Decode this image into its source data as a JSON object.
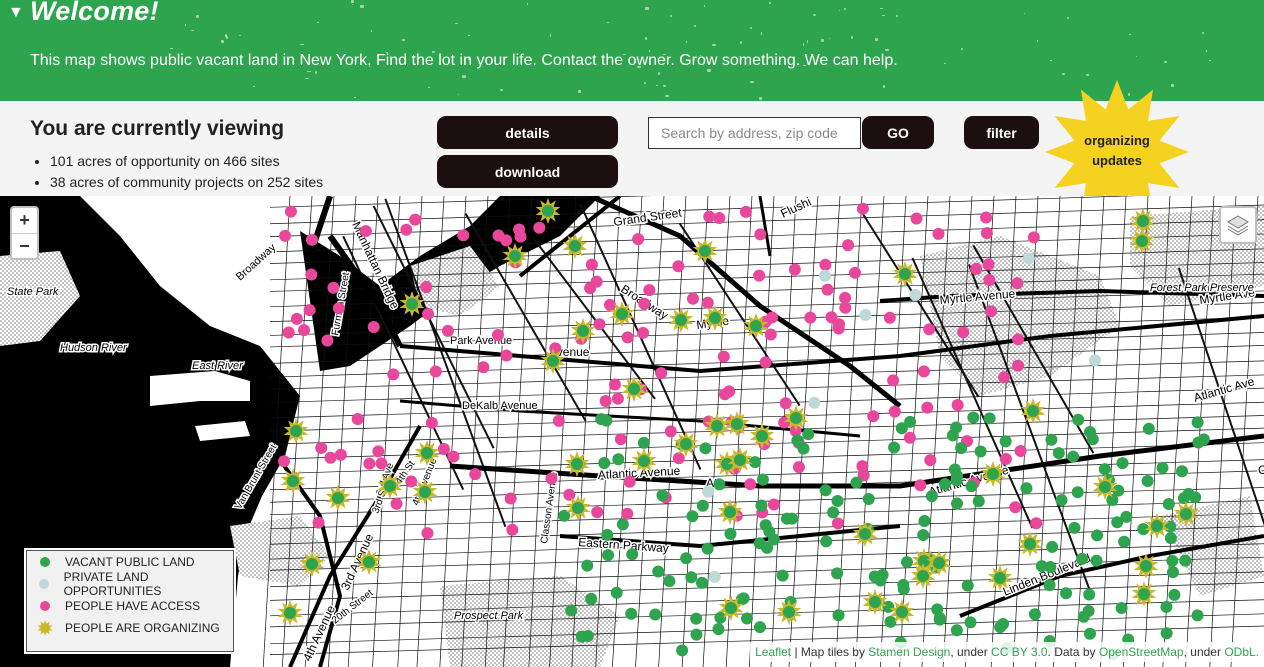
{
  "banner": {
    "title": "Welcome!",
    "collapse_glyph": "▼",
    "tagline": "This map shows public vacant land in New York. Find the lot in your life. Contact the owner. Grow something. We can help."
  },
  "panel": {
    "heading": "You are currently viewing",
    "stats": [
      "101 acres of opportunity on 466 sites",
      "38 acres of community projects on 252 sites"
    ],
    "details_label": "details",
    "download_label": "download",
    "search_placeholder": "Search by address, zip code",
    "go_label": "GO",
    "filter_label": "filter",
    "organizing_line1": "organizing",
    "organizing_line2": "updates"
  },
  "map": {
    "zoom_in": "+",
    "zoom_out": "−",
    "layers_icon": "layers-icon",
    "labels": {
      "grand_street": "Grand Street",
      "flushing": "Flushi",
      "broadway_w": "Broadway",
      "broadway_e": "Broadway",
      "manhattan_bridge": "Manhattan Bridge",
      "state_park": "State Park",
      "hudson_river": "Hudson River",
      "east_river": "East River",
      "furman": "Furman Street",
      "park_avenue": "Park Avenue",
      "dekalb": "DeKalb Avenue",
      "myrtle_w": "Myrtle",
      "myrtle_e": "Myrtle Avenue",
      "myrtle_far": "Myrtle Ave",
      "forest_park": "Forest Park Preserve",
      "atlantic_c": "Atlantic Avenue",
      "atlantic_e": "Atlantic Avenue",
      "atlantic_far": "Atlantic Ave",
      "avenue_frag": "Avenue",
      "atl_frag": "Atl",
      "classon": "Classon Avenue",
      "eastern_parkway": "Eastern Parkway",
      "linden": "Linden Boulevard",
      "prospect_park": "Prospect Park",
      "van_brunt": "Van Brunt Street",
      "third_ave": "3rd Ave",
      "fourth_avenue_mid": "4th Avenue",
      "third_avenue_lower": "3rd Avenue",
      "fourth_avenue_low": "4th Avenue",
      "twentieth": "20th Street",
      "fourth_st_frag": "4th St",
      "third_st_frag": "3rd St",
      "c_frag": "C"
    }
  },
  "legend": {
    "items": [
      {
        "label": "VACANT PUBLIC LAND",
        "kind": "dot",
        "color": "#2ea44f"
      },
      {
        "label": "PRIVATE LAND OPPORTUNITIES",
        "kind": "dot",
        "color": "#bfd8d8"
      },
      {
        "label": "PEOPLE HAVE ACCESS",
        "kind": "dot",
        "color": "#e8479b"
      },
      {
        "label": "PEOPLE ARE ORGANIZING",
        "kind": "star",
        "color": "#cbb82a"
      }
    ]
  },
  "attribution": {
    "leaflet": "Leaflet",
    "sep1": " | Map tiles by ",
    "stamen": "Stamen Design",
    "sep2": ", under ",
    "ccby": "CC BY 3.0",
    "sep3": ". Data by ",
    "osm": "OpenStreetMap",
    "sep4": ", under ",
    "odbl": "ODbL."
  },
  "colors": {
    "brand_green": "#2ea44f",
    "pink": "#e8479b",
    "private": "#bfd8d8",
    "star": "#cbb82a",
    "button": "#1b0f0f",
    "burst": "#f4d21f"
  }
}
